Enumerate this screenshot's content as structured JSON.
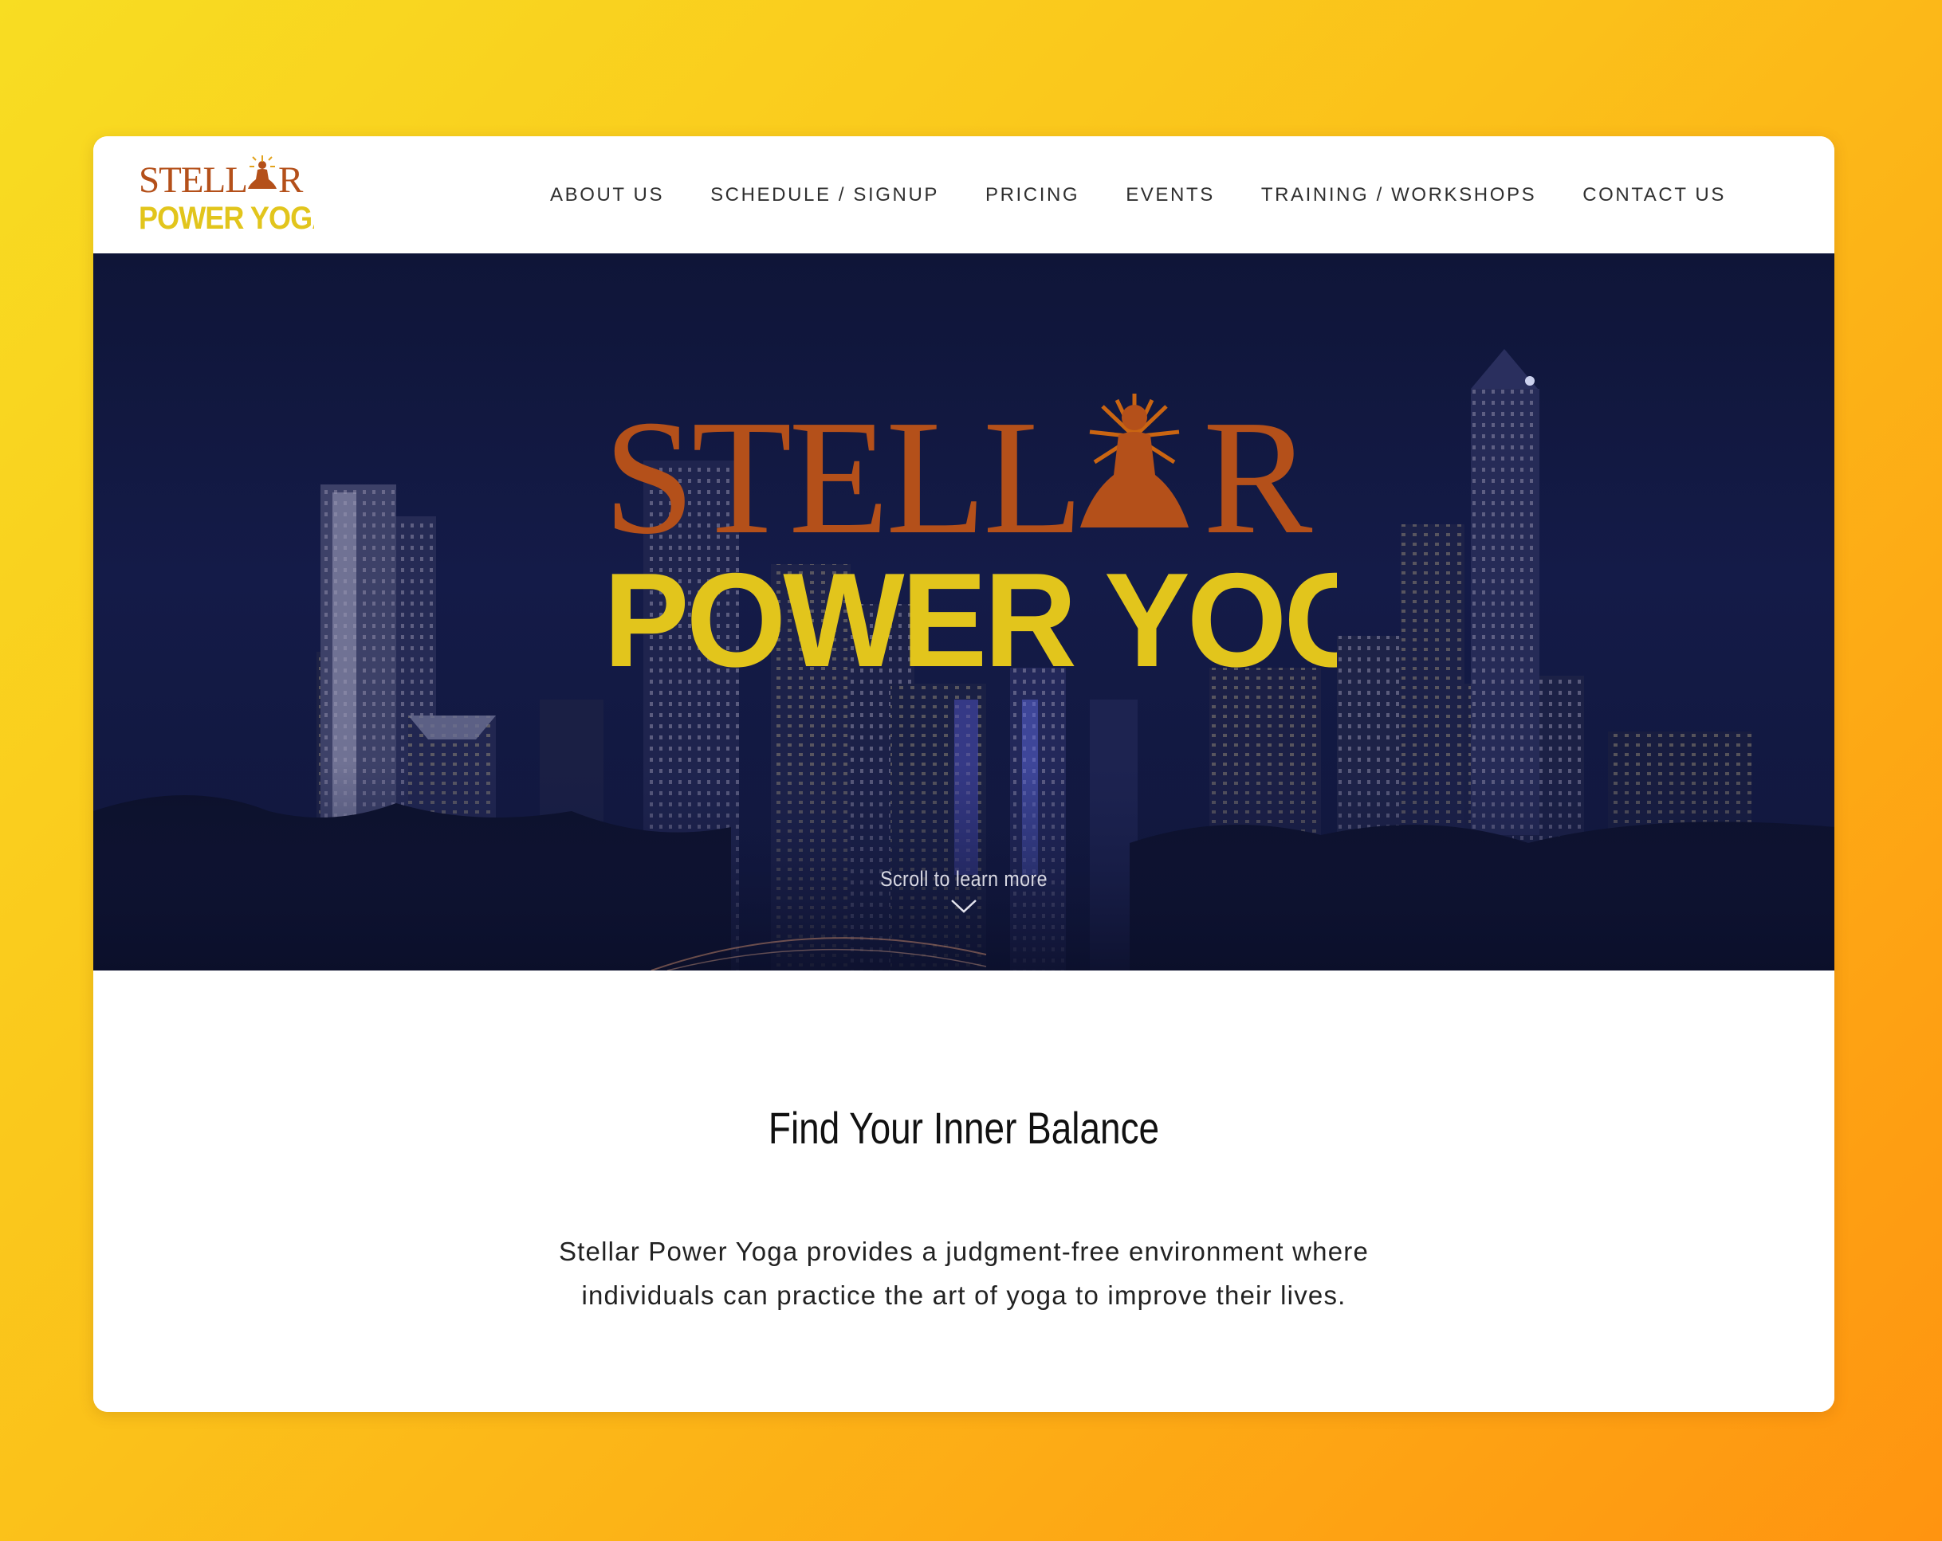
{
  "brand": {
    "logo_word_top": "STELLAR",
    "logo_word_bottom": "POWER YOGA",
    "colors": {
      "rust": "#b4501a",
      "yellow": "#e2c51c",
      "hero_navy": "#141b48"
    }
  },
  "nav": {
    "items": [
      {
        "label": "ABOUT US"
      },
      {
        "label": "SCHEDULE / SIGNUP"
      },
      {
        "label": "PRICING"
      },
      {
        "label": "EVENTS"
      },
      {
        "label": "TRAINING / WORKSHOPS"
      },
      {
        "label": "CONTACT US"
      }
    ]
  },
  "hero": {
    "scroll_label": "Scroll to learn more",
    "scroll_icon": "chevron-down-icon"
  },
  "intro": {
    "headline": "Find Your Inner Balance",
    "body_line_1": "Stellar Power Yoga provides a judgment-free environment where",
    "body_line_2": "individuals can practice the art of yoga to improve their lives."
  }
}
